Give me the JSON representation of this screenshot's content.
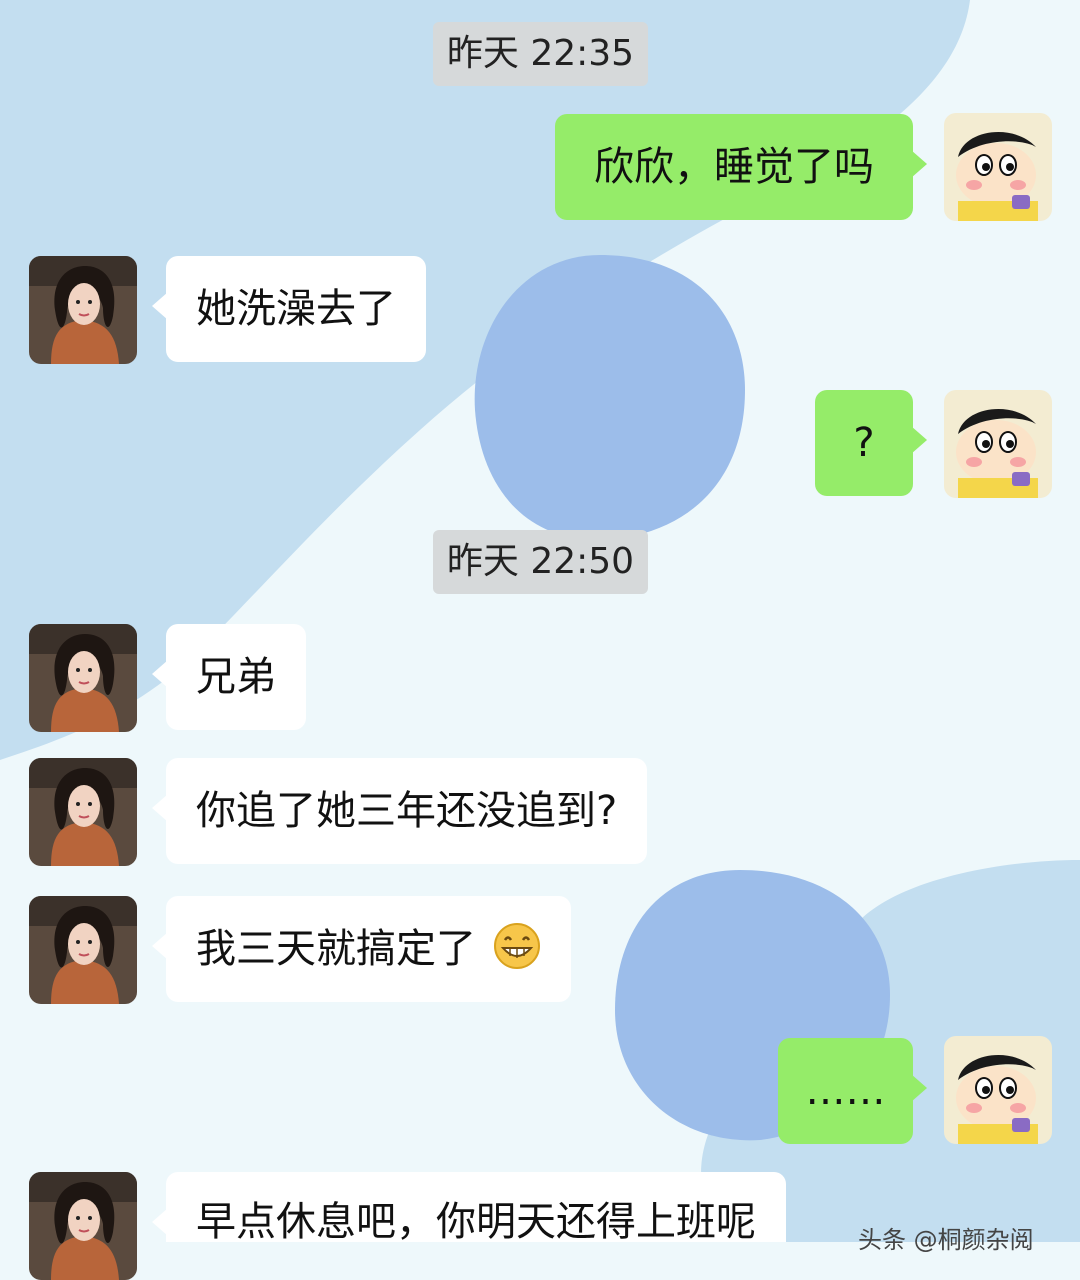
{
  "colors": {
    "outgoing_bubble": "#95ec69",
    "incoming_bubble": "#ffffff",
    "timestamp_bg": "#d6d9da",
    "background_blue": "#c3def0",
    "background_light": "#eef8fb",
    "blob": "#9cbdea"
  },
  "timestamps": [
    "昨天 22:35",
    "昨天 22:50"
  ],
  "messages": [
    {
      "side": "out",
      "text": "欣欣，睡觉了吗",
      "avatar": "crayon-shinchan-avatar"
    },
    {
      "side": "in",
      "text": "她洗澡去了",
      "avatar": "girl-portrait-avatar"
    },
    {
      "side": "out",
      "text": "?",
      "avatar": "crayon-shinchan-avatar"
    },
    {
      "side": "in",
      "text": "兄弟",
      "avatar": "girl-portrait-avatar"
    },
    {
      "side": "in",
      "text": "你追了她三年还没追到?",
      "avatar": "girl-portrait-avatar"
    },
    {
      "side": "in",
      "text": "我三天就搞定了",
      "emoji": "grin-emoji",
      "avatar": "girl-portrait-avatar"
    },
    {
      "side": "out",
      "text": "……",
      "avatar": "crayon-shinchan-avatar"
    },
    {
      "side": "in",
      "text": "早点休息吧，你明天还得上班呢",
      "avatar": "girl-portrait-avatar"
    }
  ],
  "watermark": "头条 @桐颜杂阅"
}
